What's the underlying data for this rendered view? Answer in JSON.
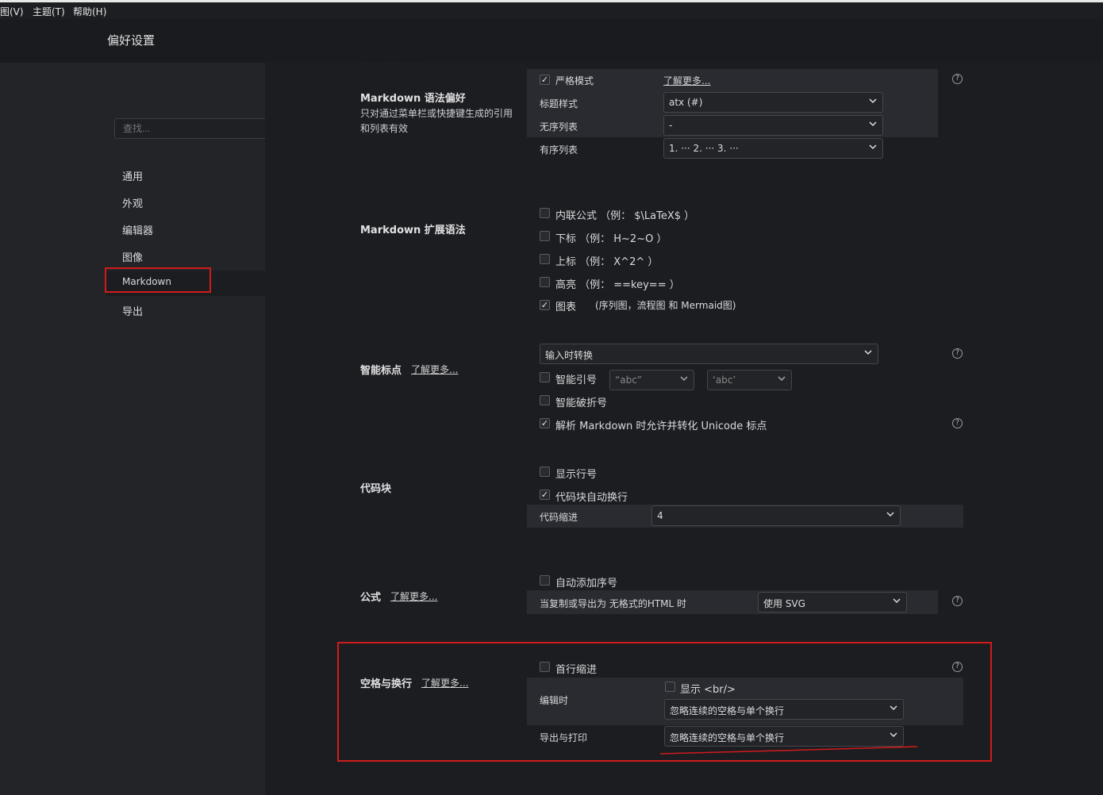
{
  "menubar": {
    "items": [
      "图(V)",
      "主题(T)",
      "帮助(H)"
    ]
  },
  "window": {
    "title": "偏好设置"
  },
  "sidebar": {
    "search_placeholder": "查找...",
    "items": [
      {
        "label": "通用"
      },
      {
        "label": "外观"
      },
      {
        "label": "编辑器"
      },
      {
        "label": "图像"
      },
      {
        "label": "Markdown",
        "active": true
      },
      {
        "label": "导出"
      }
    ]
  },
  "sections": {
    "syntax": {
      "title": "Markdown 语法偏好",
      "desc": "只对通过菜单栏或快捷键生成的引用和列表有效",
      "strict_mode": {
        "label": "严格模式",
        "checked": true
      },
      "learn_more": "了解更多...",
      "heading_style": {
        "label": "标题样式",
        "value": "atx (#)"
      },
      "unordered_list": {
        "label": "无序列表",
        "value": "-"
      },
      "ordered_list": {
        "label": "有序列表",
        "value": "1. ··· 2. ··· 3. ···"
      }
    },
    "extended": {
      "title": "Markdown 扩展语法",
      "inline_math": {
        "label": "内联公式 （例： $\\LaTeX$ ）",
        "checked": false
      },
      "subscript": {
        "label": "下标 （例： H~2~O ）",
        "checked": false
      },
      "superscript": {
        "label": "上标 （例： X^2^ ）",
        "checked": false
      },
      "highlight": {
        "label": "高亮 （例： ==key== ）",
        "checked": false
      },
      "diagrams": {
        "label": "图表",
        "note": "(序列图，流程图 和 Mermaid图)",
        "checked": true
      }
    },
    "smart_punct": {
      "title": "智能标点",
      "learn_more": "了解更多...",
      "mode": "输入时转换",
      "smart_quotes": {
        "label": "智能引号",
        "checked": false,
        "double_value": "“abc”",
        "single_value": "‘abc’"
      },
      "smart_dashes": {
        "label": "智能破折号",
        "checked": false
      },
      "unicode_punct": {
        "label": "解析 Markdown 时允许并转化 Unicode 标点",
        "checked": true
      }
    },
    "code": {
      "title": "代码块",
      "line_numbers": {
        "label": "显示行号",
        "checked": false
      },
      "wrap": {
        "label": "代码块自动换行",
        "checked": true
      },
      "indent": {
        "label": "代码缩进",
        "value": "4"
      }
    },
    "math": {
      "title": "公式",
      "learn_more": "了解更多...",
      "auto_number": {
        "label": "自动添加序号",
        "checked": false
      },
      "export_label": "当复制或导出为 无格式的HTML 时",
      "export_value": "使用 SVG"
    },
    "whitespace": {
      "title": "空格与换行",
      "learn_more": "了解更多...",
      "first_line_indent": {
        "label": "首行缩进",
        "checked": false
      },
      "show_br": {
        "label": "显示 <br/>",
        "checked": false
      },
      "editing": {
        "label": "编辑时",
        "value": "忽略连续的空格与单个换行"
      },
      "export_print": {
        "label": "导出与打印",
        "value": "忽略连续的空格与单个换行"
      }
    }
  },
  "colors": {
    "annotation_red": "#d11b1b",
    "background": "#1c1d21",
    "sidebar": "#232428"
  }
}
